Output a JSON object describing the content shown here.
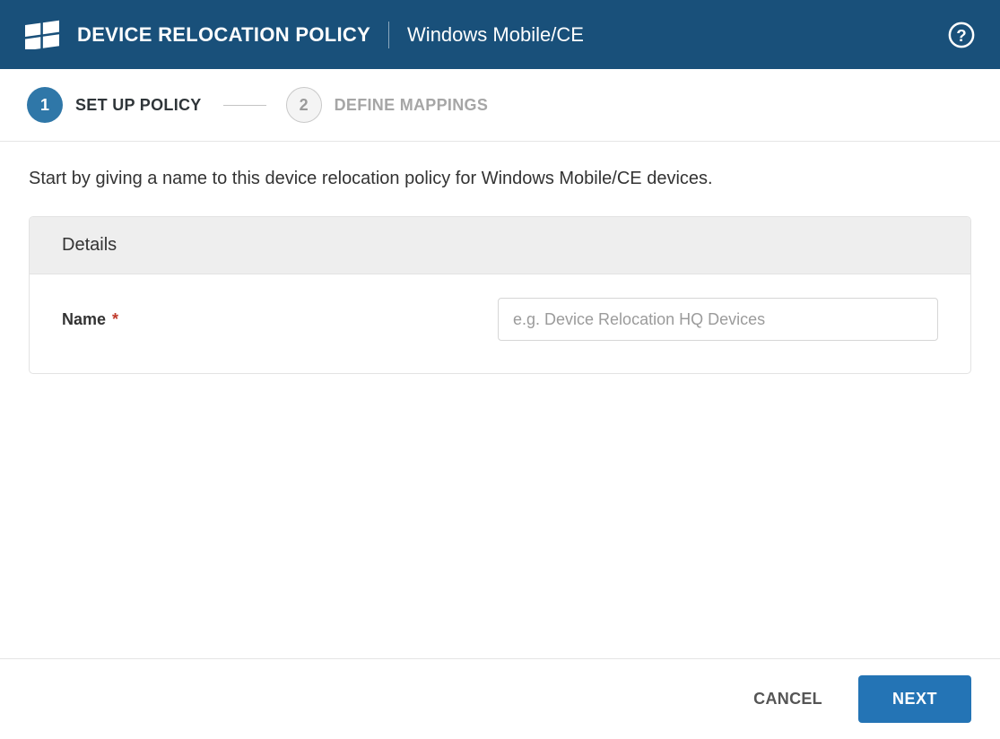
{
  "header": {
    "title": "DEVICE RELOCATION POLICY",
    "subtitle": "Windows Mobile/CE"
  },
  "stepper": {
    "steps": [
      {
        "number": "1",
        "label": "SET UP POLICY",
        "active": true
      },
      {
        "number": "2",
        "label": "DEFINE MAPPINGS",
        "active": false
      }
    ]
  },
  "main": {
    "intro": "Start by giving a name to this device relocation policy for Windows Mobile/CE devices.",
    "panel": {
      "title": "Details",
      "name_field": {
        "label": "Name",
        "required_mark": "*",
        "placeholder": "e.g. Device Relocation HQ Devices",
        "value": ""
      }
    }
  },
  "footer": {
    "cancel_label": "CANCEL",
    "next_label": "NEXT"
  }
}
